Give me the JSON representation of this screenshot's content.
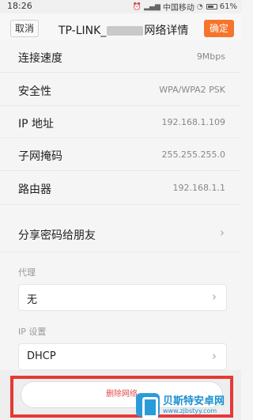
{
  "status_bar": {
    "time": "18:26",
    "carrier": "中国移动",
    "battery": "61%"
  },
  "header": {
    "cancel_label": "取消",
    "title_prefix": "TP-LINK_",
    "title_suffix": "网络详情",
    "confirm_label": "确定"
  },
  "details": [
    {
      "label": "连接速度",
      "value": "9Mbps"
    },
    {
      "label": "安全性",
      "value": "WPA/WPA2 PSK"
    },
    {
      "label": "IP 地址",
      "value": "192.168.1.109"
    },
    {
      "label": "子网掩码",
      "value": "255.255.255.0"
    },
    {
      "label": "路由器",
      "value": "192.168.1.1"
    }
  ],
  "share": {
    "label": "分享密码给朋友"
  },
  "proxy": {
    "section_title": "代理",
    "value": "无"
  },
  "ip_settings": {
    "section_title": "IP 设置",
    "value": "DHCP"
  },
  "delete": {
    "label": "删除网络"
  },
  "watermark": {
    "name": "贝斯特安卓网",
    "url": "www.zjbstyy.com"
  },
  "colors": {
    "accent": "#f6742b",
    "highlight": "#e53935",
    "delete_text": "#e04b4b"
  }
}
